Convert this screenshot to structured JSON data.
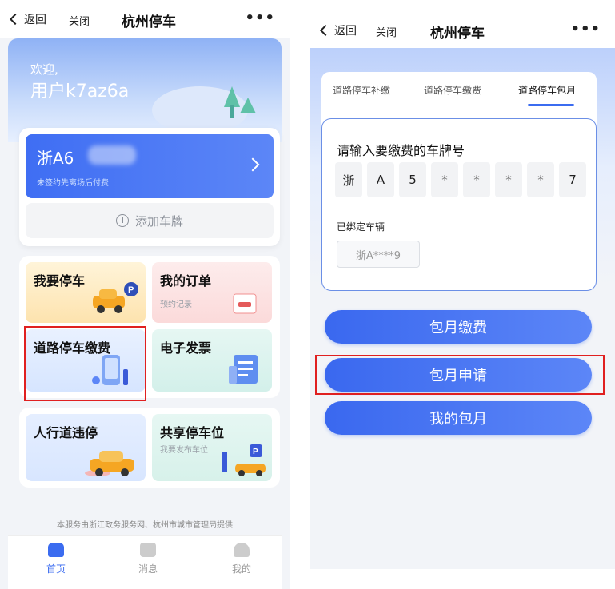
{
  "left": {
    "topbar": {
      "back": "返回",
      "close": "关闭",
      "title": "杭州停车",
      "more": "•••"
    },
    "hero": {
      "welcome": "欢迎,",
      "username": "用户k7az6a"
    },
    "plate_card": {
      "plate_prefix": "浙A6",
      "subtitle": "未签约先离场后付费",
      "add_label": "添加车牌"
    },
    "tiles": {
      "park": {
        "title": "我要停车"
      },
      "orders": {
        "title": "我的订单",
        "subtitle": "预约记录"
      },
      "road_pay": {
        "title": "道路停车缴费"
      },
      "invoice": {
        "title": "电子发票"
      },
      "sidewalk": {
        "title": "人行道违停"
      },
      "shared": {
        "title": "共享停车位",
        "subtitle": "我要发布车位"
      }
    },
    "footnote": "本服务由浙江政务服务网、杭州市城市管理局提供",
    "tabbar": [
      {
        "label": "首页",
        "icon": "home-icon",
        "active": true
      },
      {
        "label": "消息",
        "icon": "message-icon",
        "active": false
      },
      {
        "label": "我的",
        "icon": "person-icon",
        "active": false
      }
    ]
  },
  "right": {
    "topbar": {
      "back": "返回",
      "close": "关闭",
      "title": "杭州停车",
      "more": "•••"
    },
    "tabs": [
      {
        "label": "道路停车补缴",
        "active": false
      },
      {
        "label": "道路停车缴费",
        "active": false
      },
      {
        "label": "道路停车包月",
        "active": true
      }
    ],
    "input": {
      "title": "请输入要缴费的车牌号",
      "cells": [
        "浙",
        "A",
        "5",
        "*",
        "*",
        "*",
        "*",
        "7"
      ],
      "bound_label": "已绑定车辆",
      "bound_plate": "浙A****9"
    },
    "buttons": {
      "monthly_pay": "包月缴费",
      "monthly_apply": "包月申请",
      "my_monthly": "我的包月"
    }
  },
  "colors": {
    "accent": "#3b6cf0",
    "highlight": "#e02020"
  }
}
